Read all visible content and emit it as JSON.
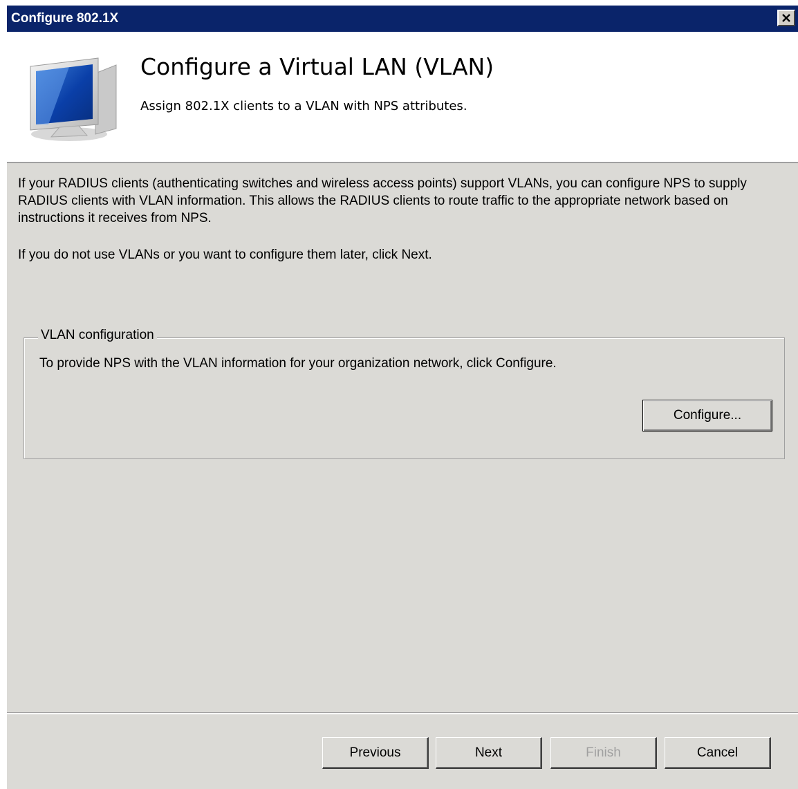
{
  "window": {
    "title": "Configure 802.1X",
    "close_label": "✕"
  },
  "header": {
    "title": "Configure a Virtual LAN (VLAN)",
    "subtitle": "Assign 802.1X clients to a VLAN with NPS attributes.",
    "icon": "computer-icon"
  },
  "body": {
    "intro": "If your RADIUS clients (authenticating switches and wireless access points) support VLANs, you can configure NPS to supply RADIUS clients with VLAN information. This allows the RADIUS clients to route traffic to the appropriate network based on instructions it receives from NPS.",
    "next_hint": "If you do not use VLANs or you want to configure them later, click Next."
  },
  "vlan_group": {
    "legend": "VLAN configuration",
    "description": "To provide NPS with the VLAN information for your organization network, click Configure.",
    "configure_label": "Configure..."
  },
  "footer": {
    "previous_label": "Previous",
    "next_label": "Next",
    "finish_label": "Finish",
    "cancel_label": "Cancel",
    "finish_disabled": true
  },
  "colors": {
    "titlebar": "#0a246a",
    "dialog_bg": "#dbdad6",
    "disabled_text": "#a0a0a0"
  }
}
